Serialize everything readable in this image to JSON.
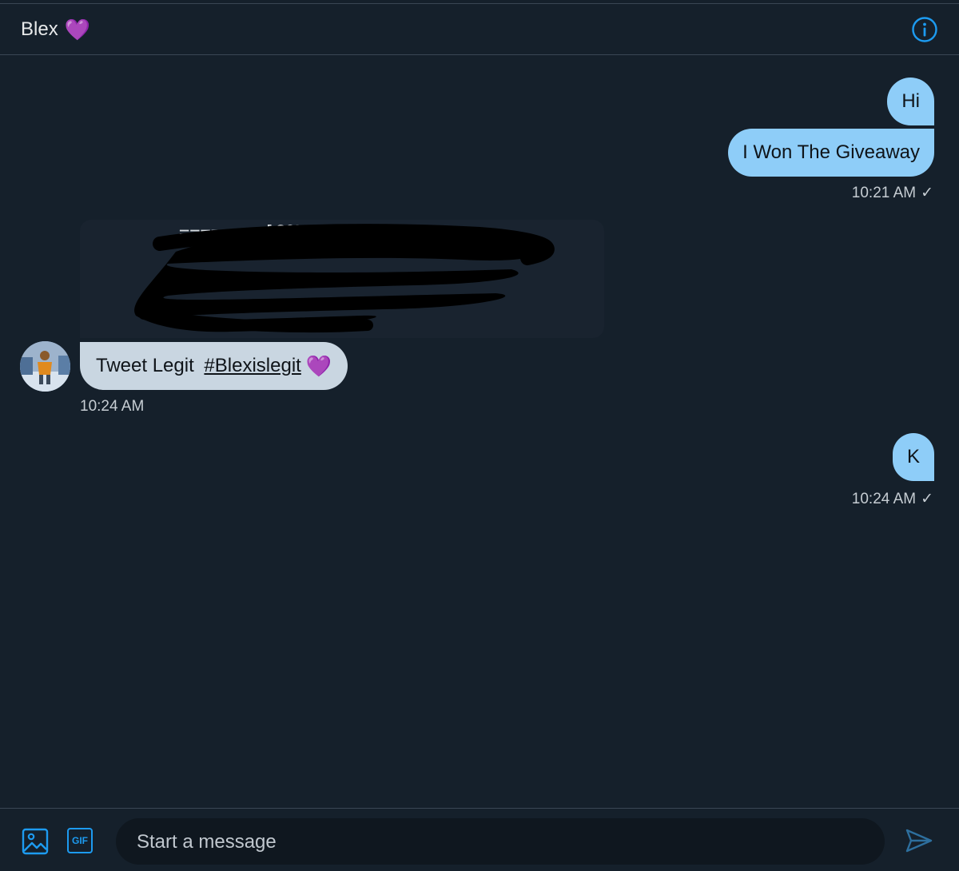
{
  "header": {
    "title": "Blex",
    "title_emoji": "💜",
    "info_icon": "info-icon"
  },
  "messages": [
    {
      "direction": "outgoing",
      "text": "Hi"
    },
    {
      "direction": "outgoing",
      "text": "I Won The Giveaway",
      "time": "10:21 AM",
      "read_mark": "✓"
    },
    {
      "direction": "incoming",
      "type": "image",
      "visible_text": "=======  [COMBO]="
    },
    {
      "direction": "incoming",
      "text_prefix": "Tweet Legit ",
      "hashtag": "#Blexislegit",
      "emoji": "💜",
      "time": "10:24 AM"
    },
    {
      "direction": "outgoing",
      "text": "K",
      "time": "10:24 AM",
      "read_mark": "✓"
    }
  ],
  "composer": {
    "placeholder": "Start a message",
    "media_icon": "image-icon",
    "gif_label": "GIF",
    "send_icon": "send-icon"
  },
  "colors": {
    "background": "#15202b",
    "outgoing_bubble": "#8ecdf8",
    "incoming_bubble": "#c9d6e1",
    "accent": "#1d9bf0",
    "heart": "#a855f7"
  }
}
